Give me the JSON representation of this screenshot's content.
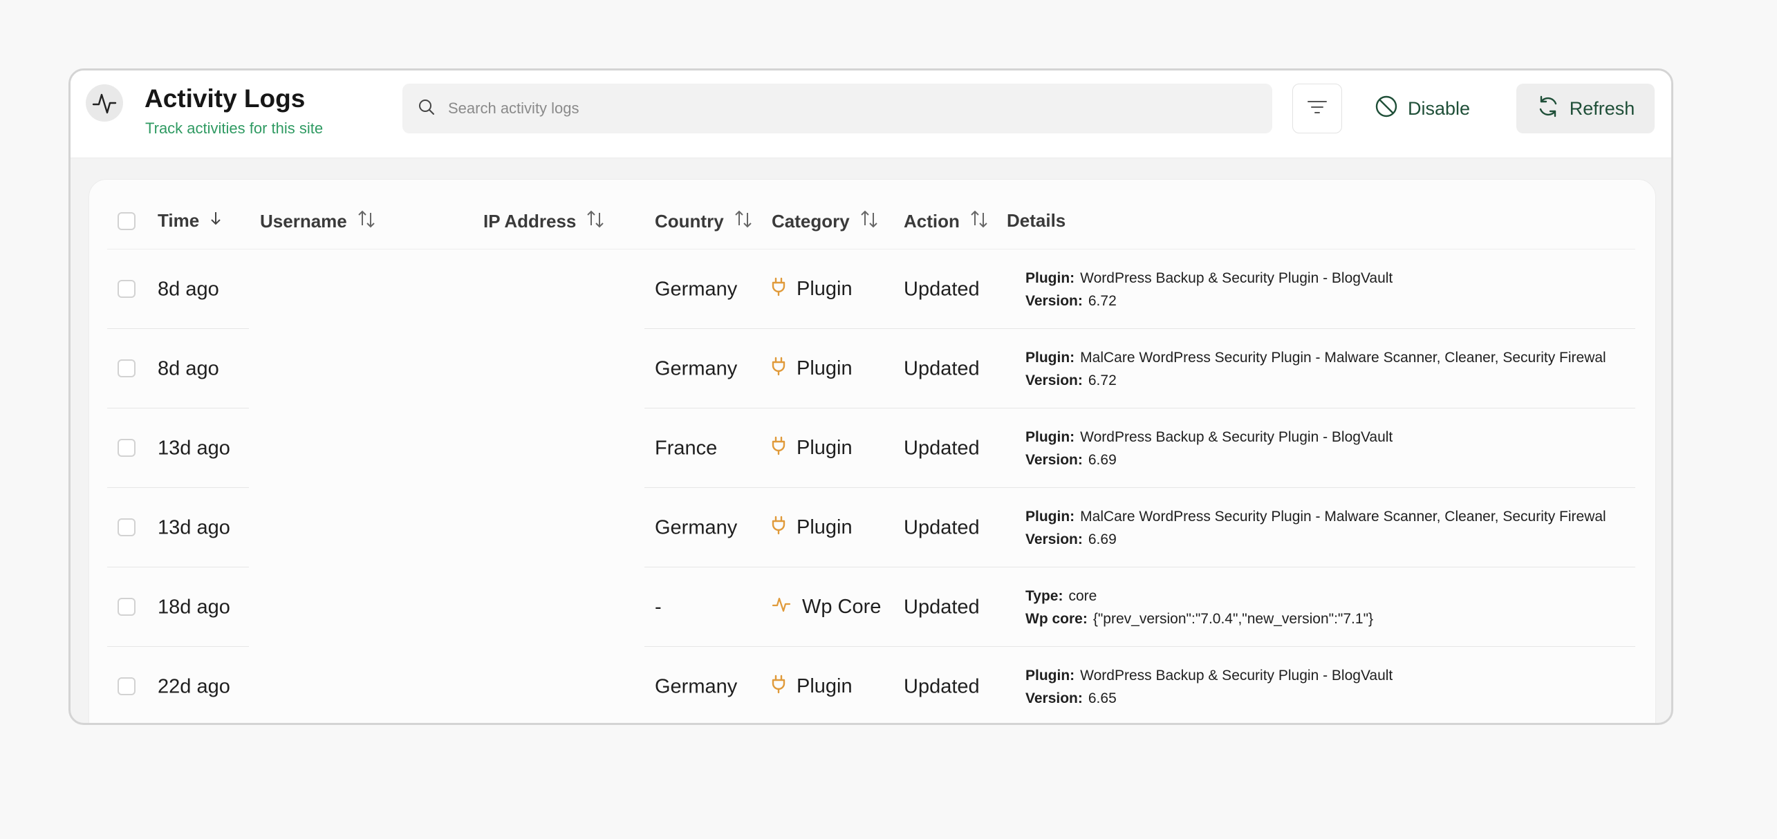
{
  "header": {
    "title": "Activity Logs",
    "subtitle": "Track activities for this site",
    "search_placeholder": "Search activity logs",
    "disable_label": "Disable",
    "refresh_label": "Refresh"
  },
  "table": {
    "columns": {
      "time": "Time",
      "username": "Username",
      "ip": "IP Address",
      "country": "Country",
      "category": "Category",
      "action": "Action",
      "details": "Details"
    },
    "rows": [
      {
        "time": "8d ago",
        "country": "Germany",
        "category": "Plugin",
        "action": "Updated",
        "d1_label": "Plugin:",
        "d1_value": "WordPress Backup & Security Plugin - BlogVault",
        "d2_label": "Version:",
        "d2_value": "6.72"
      },
      {
        "time": "8d ago",
        "country": "Germany",
        "category": "Plugin",
        "action": "Updated",
        "d1_label": "Plugin:",
        "d1_value": "MalCare WordPress Security Plugin - Malware Scanner, Cleaner, Security Firewal",
        "d2_label": "Version:",
        "d2_value": "6.72"
      },
      {
        "time": "13d ago",
        "country": "France",
        "category": "Plugin",
        "action": "Updated",
        "d1_label": "Plugin:",
        "d1_value": "WordPress Backup & Security Plugin - BlogVault",
        "d2_label": "Version:",
        "d2_value": "6.69"
      },
      {
        "time": "13d ago",
        "country": "Germany",
        "category": "Plugin",
        "action": "Updated",
        "d1_label": "Plugin:",
        "d1_value": "MalCare WordPress Security Plugin - Malware Scanner, Cleaner, Security Firewal",
        "d2_label": "Version:",
        "d2_value": "6.69"
      },
      {
        "time": "18d ago",
        "country": "-",
        "category": "Wp Core",
        "action": "Updated",
        "d1_label": "Type:",
        "d1_value": "core",
        "d2_label": "Wp core:",
        "d2_value": "{\"prev_version\":\"7.0.4\",\"new_version\":\"7.1\"}"
      },
      {
        "time": "22d ago",
        "country": "Germany",
        "category": "Plugin",
        "action": "Updated",
        "d1_label": "Plugin:",
        "d1_value": "WordPress Backup & Security Plugin - BlogVault",
        "d2_label": "Version:",
        "d2_value": "6.65"
      }
    ]
  },
  "colors": {
    "accent": "#2f9a62",
    "category_icon": "#e09a3a",
    "button_text": "#1f4f38"
  },
  "icons": {
    "app": "activity-icon",
    "search": "search-icon",
    "filter": "filter-icon",
    "disable": "block-icon",
    "refresh": "refresh-icon",
    "plugin": "plug-icon",
    "core": "activity-icon",
    "sort": "sort-icon",
    "sort_desc": "arrow-down-icon"
  }
}
